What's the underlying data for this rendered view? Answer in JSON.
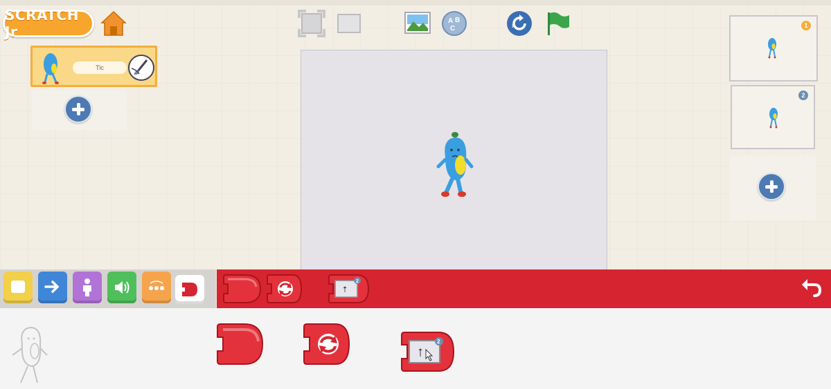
{
  "app": {
    "logo_text": "SCRATCH Jr"
  },
  "top_toolbar": {
    "home_icon": "home-icon",
    "fullscreen_icon": "fullscreen-icon",
    "presentation_icon": "presentation-mode-icon",
    "background_icon": "landscape-icon",
    "text_icon": "text-abc-icon",
    "reset_icon": "reset-icon",
    "flag_icon": "green-flag-icon"
  },
  "sprites": {
    "items": [
      {
        "name": "Tic",
        "selected": true
      }
    ],
    "add_icon": "plus-icon"
  },
  "pages": {
    "items": [
      {
        "number": "1",
        "active": true
      },
      {
        "number": "2",
        "active": false
      }
    ],
    "add_icon": "plus-icon"
  },
  "categories": [
    {
      "name": "triggering",
      "color": "#f2d04a"
    },
    {
      "name": "motion",
      "color": "#3f86d9"
    },
    {
      "name": "looks",
      "color": "#b173d6"
    },
    {
      "name": "sound",
      "color": "#4fbf5b"
    },
    {
      "name": "control",
      "color": "#f6a44c"
    },
    {
      "name": "end",
      "color": "#d62530",
      "selected": true
    }
  ],
  "palette": {
    "color": "#d62530",
    "blocks": [
      {
        "name": "end-block"
      },
      {
        "name": "repeat-forever-block"
      },
      {
        "name": "go-to-page-block",
        "page": "2"
      }
    ],
    "undo_icon": "undo-icon"
  },
  "script_blocks": [
    {
      "name": "end-block"
    },
    {
      "name": "repeat-forever-block"
    },
    {
      "name": "go-to-page-block",
      "page": "2"
    }
  ]
}
